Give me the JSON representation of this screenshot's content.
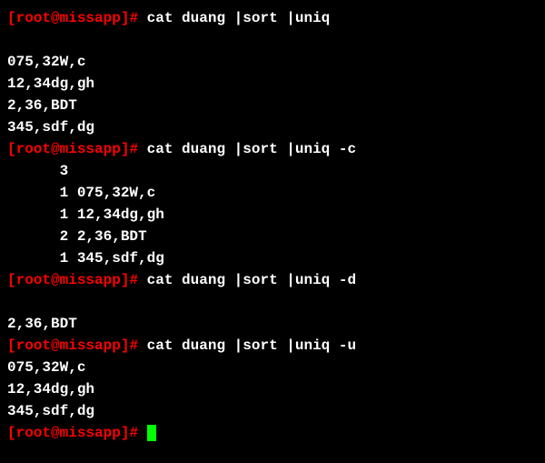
{
  "prompt": {
    "open": "[",
    "user": "root@missapp",
    "close": "]",
    "hash": "#"
  },
  "blocks": [
    {
      "command": " cat duang |sort |uniq",
      "output": [
        "",
        "075,32W,c",
        "12,34dg,gh",
        "2,36,BDT",
        "345,sdf,dg"
      ]
    },
    {
      "command": " cat duang |sort |uniq -c",
      "output": [
        "      3",
        "      1 075,32W,c",
        "      1 12,34dg,gh",
        "      2 2,36,BDT",
        "      1 345,sdf,dg"
      ]
    },
    {
      "command": " cat duang |sort |uniq -d",
      "output": [
        "",
        "2,36,BDT"
      ]
    },
    {
      "command": " cat duang |sort |uniq -u",
      "output": [
        "075,32W,c",
        "12,34dg,gh",
        "345,sdf,dg"
      ]
    }
  ]
}
